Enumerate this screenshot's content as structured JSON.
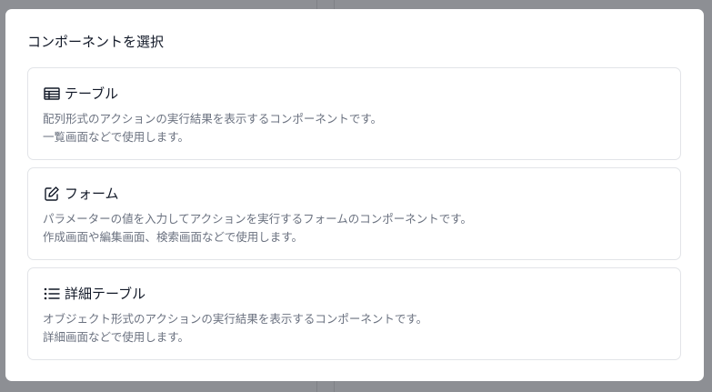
{
  "dialog": {
    "title": "コンポーネントを選択"
  },
  "components": [
    {
      "icon": "table-icon",
      "title": "テーブル",
      "description": [
        "配列形式のアクションの実行結果を表示するコンポーネントです。",
        "一覧画面などで使用します。"
      ]
    },
    {
      "icon": "edit-icon",
      "title": "フォーム",
      "description": [
        "パラメーターの値を入力してアクションを実行するフォームのコンポーネントです。",
        "作成画面や編集画面、検索画面などで使用します。"
      ]
    },
    {
      "icon": "list-icon",
      "title": "詳細テーブル",
      "description": [
        "オブジェクト形式のアクションの実行結果を表示するコンポーネントです。",
        "詳細画面などで使用します。"
      ]
    }
  ]
}
